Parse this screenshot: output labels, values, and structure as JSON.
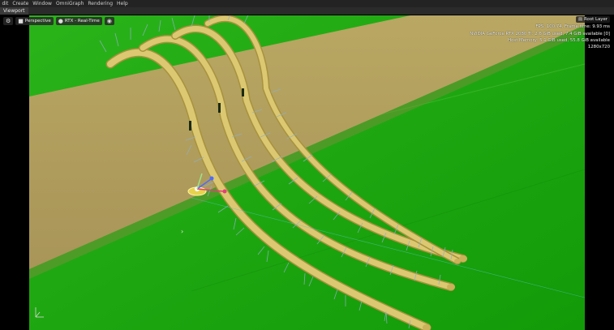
{
  "menu": [
    "dit",
    "Create",
    "Window",
    "OmniGraph",
    "Rendering",
    "Help"
  ],
  "tab": {
    "label": "Viewport"
  },
  "toolbar": {
    "settings_icon": "gear-icon",
    "camera_icon": "camera-icon",
    "camera_label": "Perspective",
    "render_icon": "bulb-icon",
    "render_label": "RTX - Real-Time",
    "visibility_icon": "eye-icon"
  },
  "hud": {
    "layer_icon": "layers-icon",
    "layer_label": "Root Layer",
    "fps": "FPS: 100.74, Frame time: 9.93 ms",
    "gpu": "NVIDIA GeForce RTX 2080 Ti: 2.6 GiB used, 7.4 GiB available [0]",
    "memory": "Host Memory: 5.1 GiB used, 55.8 GiB available",
    "resolution": "1280x720"
  },
  "scene": {
    "ground_color": "#1ea60f",
    "beam_color": "#c9b36a",
    "tube_color": "#d4c06a",
    "gizmo_icon": "transform-gizmo-icon",
    "axis_icon": "axis-indicator-icon",
    "cursor_glyph": "›"
  }
}
